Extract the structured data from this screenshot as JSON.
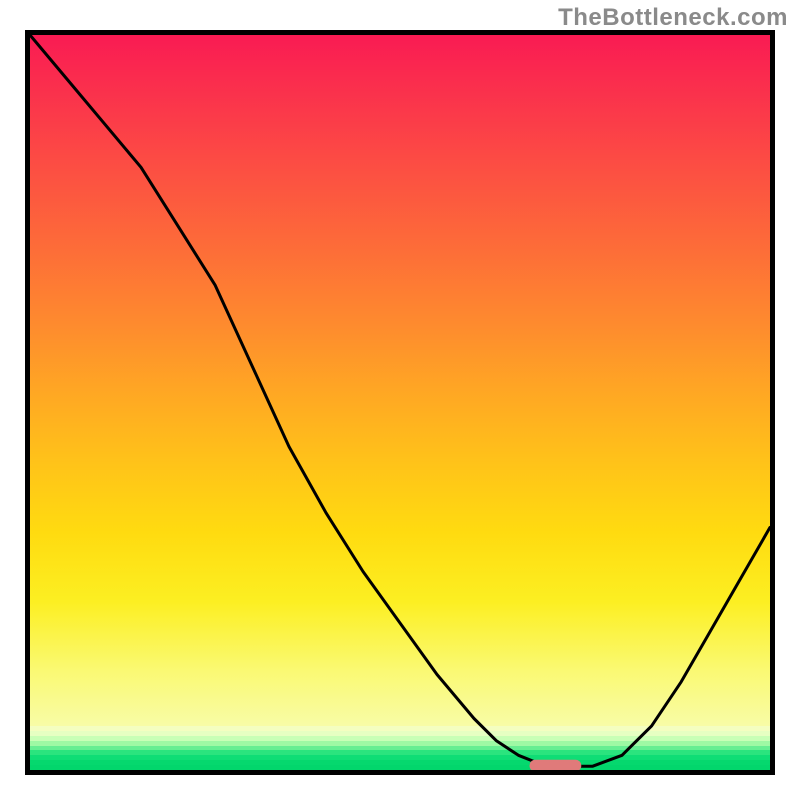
{
  "watermark_text": "TheBottleneck.com",
  "chart_data": {
    "type": "line",
    "title": "",
    "xlabel": "",
    "ylabel": "",
    "xlim": [
      0,
      100
    ],
    "ylim": [
      0,
      100
    ],
    "background_gradient": {
      "stops": [
        {
          "pos": 0.0,
          "color": "#f91b53"
        },
        {
          "pos": 0.18,
          "color": "#fc4b44"
        },
        {
          "pos": 0.42,
          "color": "#fe8b2e"
        },
        {
          "pos": 0.62,
          "color": "#ffc319"
        },
        {
          "pos": 0.82,
          "color": "#fcef22"
        },
        {
          "pos": 0.94,
          "color": "#f8fca6"
        },
        {
          "pos": 0.97,
          "color": "#9ef9a4"
        },
        {
          "pos": 1.0,
          "color": "#02d66c"
        }
      ]
    },
    "series": [
      {
        "name": "bottleneck-curve",
        "color": "#000000",
        "x": [
          0.0,
          5,
          10,
          15,
          20,
          25,
          30,
          35,
          40,
          45,
          50,
          55,
          60,
          63,
          66,
          69,
          72,
          76,
          80,
          84,
          88,
          92,
          96,
          100
        ],
        "y": [
          100.0,
          94,
          88,
          82,
          74,
          66,
          55,
          44,
          35,
          27,
          20,
          13,
          7,
          4,
          2,
          0.8,
          0.5,
          0.5,
          2,
          6,
          12,
          19,
          26,
          33
        ]
      }
    ],
    "marker": {
      "name": "optimal-marker",
      "shape": "rounded-rect",
      "color": "#e07a7a",
      "x": 71,
      "y": 0.6,
      "width": 7,
      "height": 1.6
    }
  }
}
